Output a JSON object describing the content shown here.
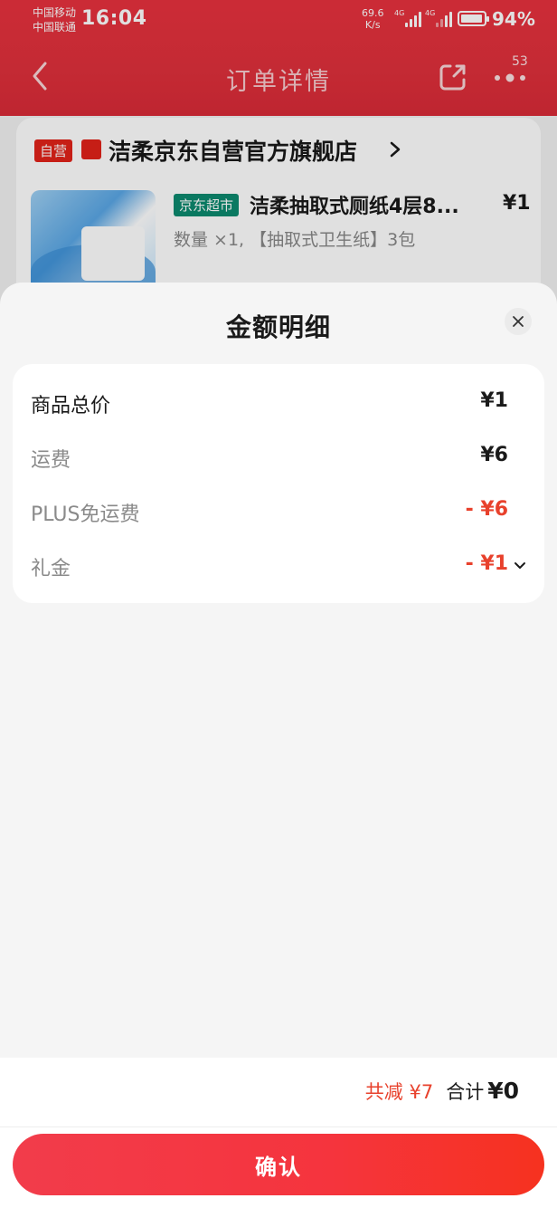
{
  "status_bar": {
    "carrier_1": "中国移动",
    "carrier_2": "中国联通",
    "time": "16:04",
    "net_speed_value": "69.6",
    "net_speed_unit": "K/s",
    "signal_tag_1": "4G",
    "signal_tag_2": "4G",
    "battery_level": 0.94,
    "battery_percent": "94%"
  },
  "nav": {
    "title": "订单详情",
    "back_icon": "chevron-left-icon",
    "share_icon": "share-icon",
    "more_icon": "more-dots-icon",
    "badge": "53"
  },
  "store": {
    "self_tag": "自营",
    "name": "洁柔京东自营官方旗舰店",
    "market_tag": "京东超市",
    "product_name": "洁柔抽取式厕纸4层8...",
    "product_price": "¥1",
    "product_spec": "数量 ×1, 【抽取式卫生纸】3包"
  },
  "sheet": {
    "title": "金额明细",
    "rows": [
      {
        "label": "商品总价",
        "value": "¥1"
      },
      {
        "label": "运费",
        "value": "¥6"
      },
      {
        "label": "PLUS免运费",
        "value": "- ¥6"
      },
      {
        "label": "礼金",
        "value": "- ¥1"
      }
    ]
  },
  "footer": {
    "saved": "共减 ¥7",
    "total_label": "合计",
    "total_value": "¥0",
    "confirm": "确认"
  },
  "colors": {
    "brand_red": "#e2231a",
    "accent_red": "#e8412c",
    "market_green": "#0c8a6f"
  }
}
